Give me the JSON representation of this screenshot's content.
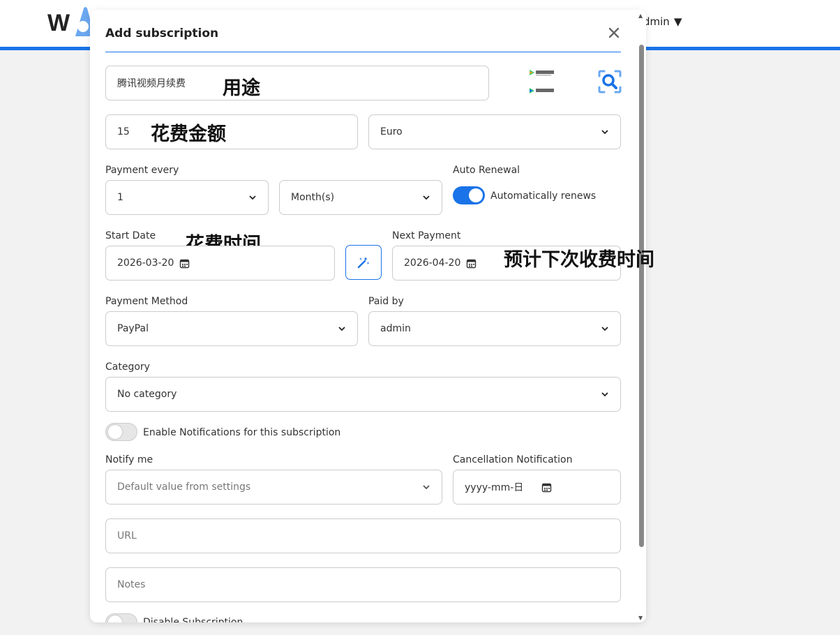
{
  "app": {
    "logo_letter": "W",
    "user_label": "dmin",
    "user_caret": "▼"
  },
  "modal": {
    "title": "Add subscription",
    "name_value": "腾讯视频月续费",
    "amount_value": "15",
    "currency_value": "Euro",
    "payment_every_label": "Payment every",
    "cycle_value": "1",
    "frequency_value": "Month(s)",
    "auto_renewal_label": "Auto Renewal",
    "auto_renew_text": "Automatically renews",
    "auto_renew_on": true,
    "start_date_label": "Start Date",
    "start_date_value": "2026-03-20",
    "next_payment_label": "Next Payment",
    "next_payment_value": "2026-04-20",
    "payment_method_label": "Payment Method",
    "payment_method_value": "PayPal",
    "paid_by_label": "Paid by",
    "paid_by_value": "admin",
    "category_label": "Category",
    "category_value": "No category",
    "notifications_text": "Enable Notifications for this subscription",
    "notify_me_label": "Notify me",
    "notify_me_value": "Default value from settings",
    "cancellation_label": "Cancellation Notification",
    "cancellation_placeholder": "yyyy-mm-日",
    "url_placeholder": "URL",
    "notes_placeholder": "Notes",
    "disable_text": "Disable Subscription"
  },
  "annotations": {
    "purpose": "用途",
    "amount": "花费金额",
    "spend_time": "花费时间",
    "next_charge": "预计下次收费时间"
  },
  "colors": {
    "accent": "#1a73e8",
    "background": "#f2f2f2"
  }
}
